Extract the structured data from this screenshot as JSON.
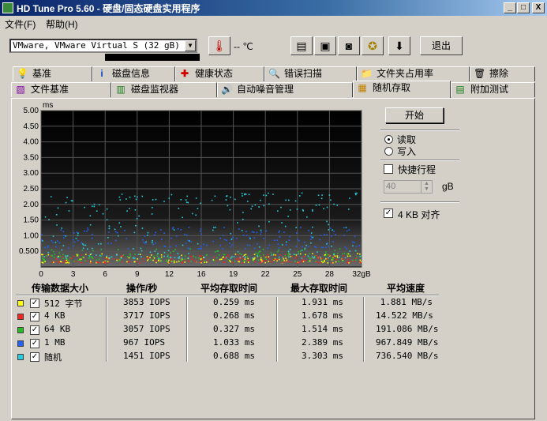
{
  "window": {
    "title": "HD Tune Pro 5.60 - 硬盘/固态硬盘实用程序",
    "minimize": "_",
    "maximize": "□",
    "close": "X"
  },
  "menu": {
    "items": [
      "文件(F)",
      "帮助(H)"
    ]
  },
  "toolbar": {
    "drive": "VMware, VMware Virtual S (32 gB)",
    "temperature": "-- ℃",
    "exit_label": "退出",
    "icons": [
      "thermometer-icon",
      "copy-text-icon",
      "copy-screen-icon",
      "camera-icon",
      "options-icon",
      "download-icon"
    ]
  },
  "tabs": {
    "row1": [
      {
        "label": "基准",
        "icon": "bulb-icon"
      },
      {
        "label": "磁盘信息",
        "icon": "info-icon"
      },
      {
        "label": "健康状态",
        "icon": "health-icon"
      },
      {
        "label": "错误扫描",
        "icon": "magnifier-icon"
      },
      {
        "label": "文件夹占用率",
        "icon": "folder-icon"
      },
      {
        "label": "擦除",
        "icon": "trash-icon"
      }
    ],
    "row2": [
      {
        "label": "文件基准",
        "icon": "file-icon"
      },
      {
        "label": "磁盘监视器",
        "icon": "monitor-icon"
      },
      {
        "label": "自动噪音管理",
        "icon": "speaker-icon"
      },
      {
        "label": "随机存取",
        "icon": "random-icon",
        "active": true
      },
      {
        "label": "附加测试",
        "icon": "extra-icon"
      }
    ]
  },
  "controls": {
    "start_label": "开始",
    "read_label": "读取",
    "write_label": "写入",
    "mode_selected": "read",
    "quick_label": "快捷行程",
    "quick_checked": false,
    "quick_value": "40",
    "quick_unit": "gB",
    "align_label": "4 KB 对齐",
    "align_checked": true
  },
  "chart_data": {
    "type": "scatter",
    "ylabel": "ms",
    "xlabel": "gB",
    "x_ticks": [
      "0",
      "3",
      "6",
      "9",
      "12",
      "16",
      "19",
      "22",
      "25",
      "28",
      "32gB"
    ],
    "y_ticks": [
      "5.00",
      "4.50",
      "4.00",
      "3.50",
      "3.00",
      "2.50",
      "2.00",
      "1.50",
      "1.00",
      "0.500"
    ],
    "xlim": [
      0,
      32
    ],
    "ylim": [
      0,
      5
    ],
    "grid": true,
    "background": "#000000",
    "series": [
      {
        "name": "512 字节",
        "color": "#ffff00",
        "band": [
          0.15,
          0.45
        ]
      },
      {
        "name": "4 KB",
        "color": "#ff2020",
        "band": [
          0.15,
          0.42
        ]
      },
      {
        "name": "64 KB",
        "color": "#20c020",
        "band": [
          0.2,
          0.6
        ]
      },
      {
        "name": "1 MB",
        "color": "#2060ff",
        "band": [
          0.6,
          1.3
        ]
      },
      {
        "name": "随机",
        "color": "#20d0e0",
        "band": [
          0.3,
          2.4
        ]
      }
    ]
  },
  "stats": {
    "headers": [
      "传输数据大小",
      "操作/秒",
      "平均存取时间",
      "最大存取时间",
      "平均速度"
    ],
    "rows": [
      {
        "size": "512 字节",
        "color": "#ffff00",
        "checked": true,
        "ops": "3853 IOPS",
        "avg": "0.259 ms",
        "max": "1.931 ms",
        "speed": "1.881 MB/s"
      },
      {
        "size": "4 KB",
        "color": "#ff2020",
        "checked": true,
        "ops": "3717 IOPS",
        "avg": "0.268 ms",
        "max": "1.678 ms",
        "speed": "14.522 MB/s"
      },
      {
        "size": "64 KB",
        "color": "#20c020",
        "checked": true,
        "ops": "3057 IOPS",
        "avg": "0.327 ms",
        "max": "1.514 ms",
        "speed": "191.086 MB/s"
      },
      {
        "size": "1 MB",
        "color": "#2060ff",
        "checked": true,
        "ops": "967 IOPS",
        "avg": "1.033 ms",
        "max": "2.389 ms",
        "speed": "967.849 MB/s"
      },
      {
        "size": "随机",
        "color": "#20d0e0",
        "checked": true,
        "ops": "1451 IOPS",
        "avg": "0.688 ms",
        "max": "3.303 ms",
        "speed": "736.540 MB/s"
      }
    ]
  }
}
